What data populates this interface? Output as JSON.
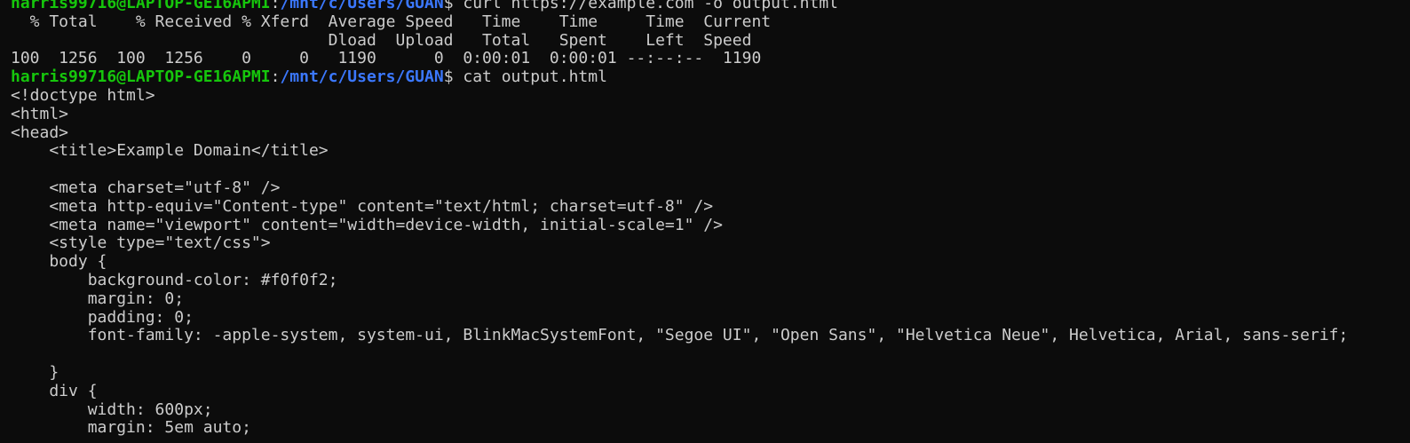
{
  "prompt": {
    "user_host": "harris99716@LAPTOP-GE16APMI",
    "separator": ":",
    "path": "/mnt/c/Users/GUAN",
    "symbol": "$ "
  },
  "commands": [
    "curl https://example.com -o output.html",
    "cat output.html"
  ],
  "curl_output": [
    "  % Total    % Received % Xferd  Average Speed   Time    Time     Time  Current",
    "                                 Dload  Upload   Total   Spent    Left  Speed",
    "100  1256  100  1256    0     0   1190      0  0:00:01  0:00:01 --:--:--  1190"
  ],
  "file_lines": [
    "<!doctype html>",
    "<html>",
    "<head>",
    "    <title>Example Domain</title>",
    "",
    "    <meta charset=\"utf-8\" />",
    "    <meta http-equiv=\"Content-type\" content=\"text/html; charset=utf-8\" />",
    "    <meta name=\"viewport\" content=\"width=device-width, initial-scale=1\" />",
    "    <style type=\"text/css\">",
    "    body {",
    "        background-color: #f0f0f2;",
    "        margin: 0;",
    "        padding: 0;",
    "        font-family: -apple-system, system-ui, BlinkMacSystemFont, \"Segoe UI\", \"Open Sans\", \"Helvetica Neue\", Helvetica, Arial, sans-serif;",
    "",
    "    }",
    "    div {",
    "        width: 600px;",
    "        margin: 5em auto;"
  ],
  "colors": {
    "background": "#0c0c0c",
    "foreground": "#cccccc",
    "prompt_user": "#16c60c",
    "prompt_path": "#3b78ff"
  }
}
